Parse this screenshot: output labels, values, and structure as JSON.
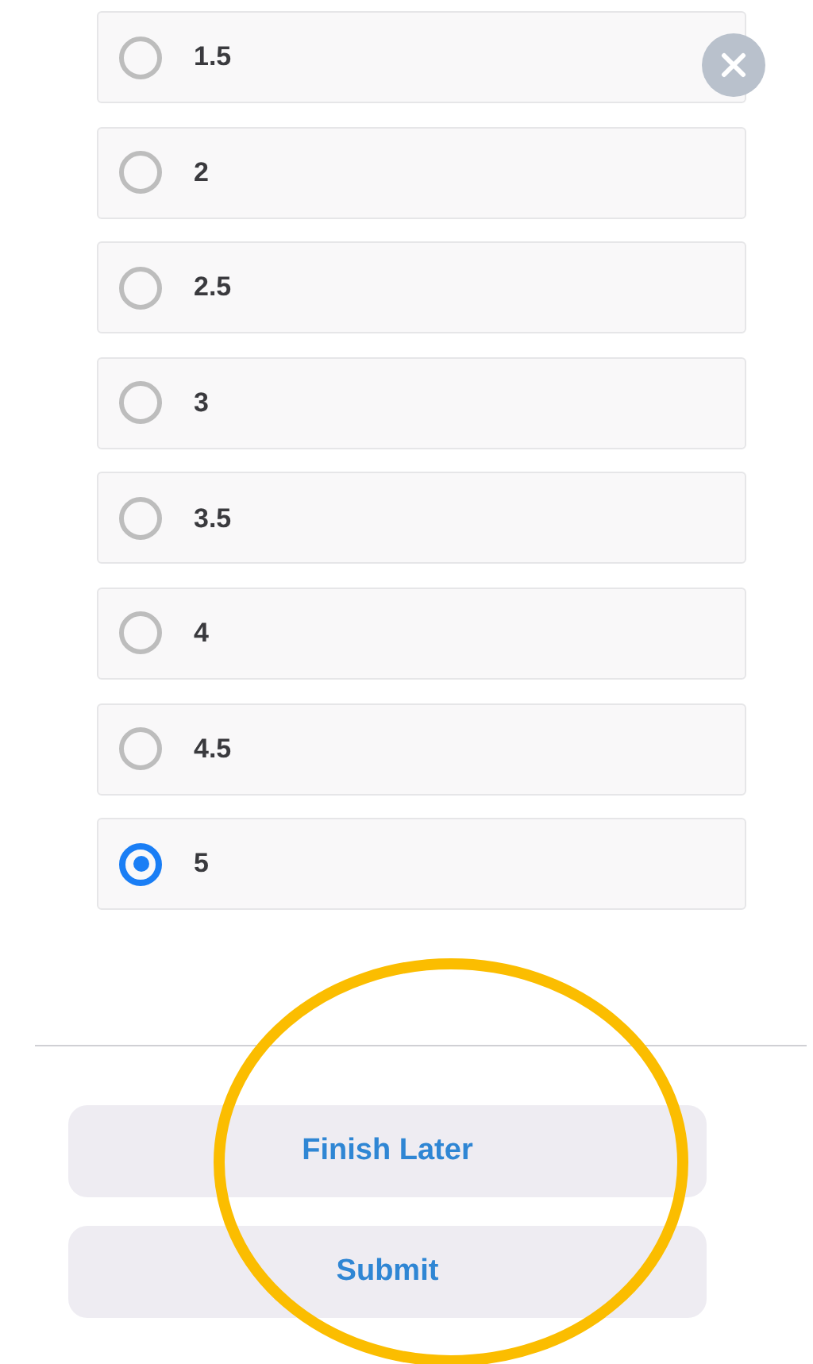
{
  "options": [
    {
      "label": "1.5",
      "selected": false
    },
    {
      "label": "2",
      "selected": false
    },
    {
      "label": "2.5",
      "selected": false
    },
    {
      "label": "3",
      "selected": false
    },
    {
      "label": "3.5",
      "selected": false
    },
    {
      "label": "4",
      "selected": false
    },
    {
      "label": "4.5",
      "selected": false
    },
    {
      "label": "5",
      "selected": true
    }
  ],
  "buttons": [
    {
      "label": "Finish Later"
    },
    {
      "label": "Submit"
    }
  ]
}
